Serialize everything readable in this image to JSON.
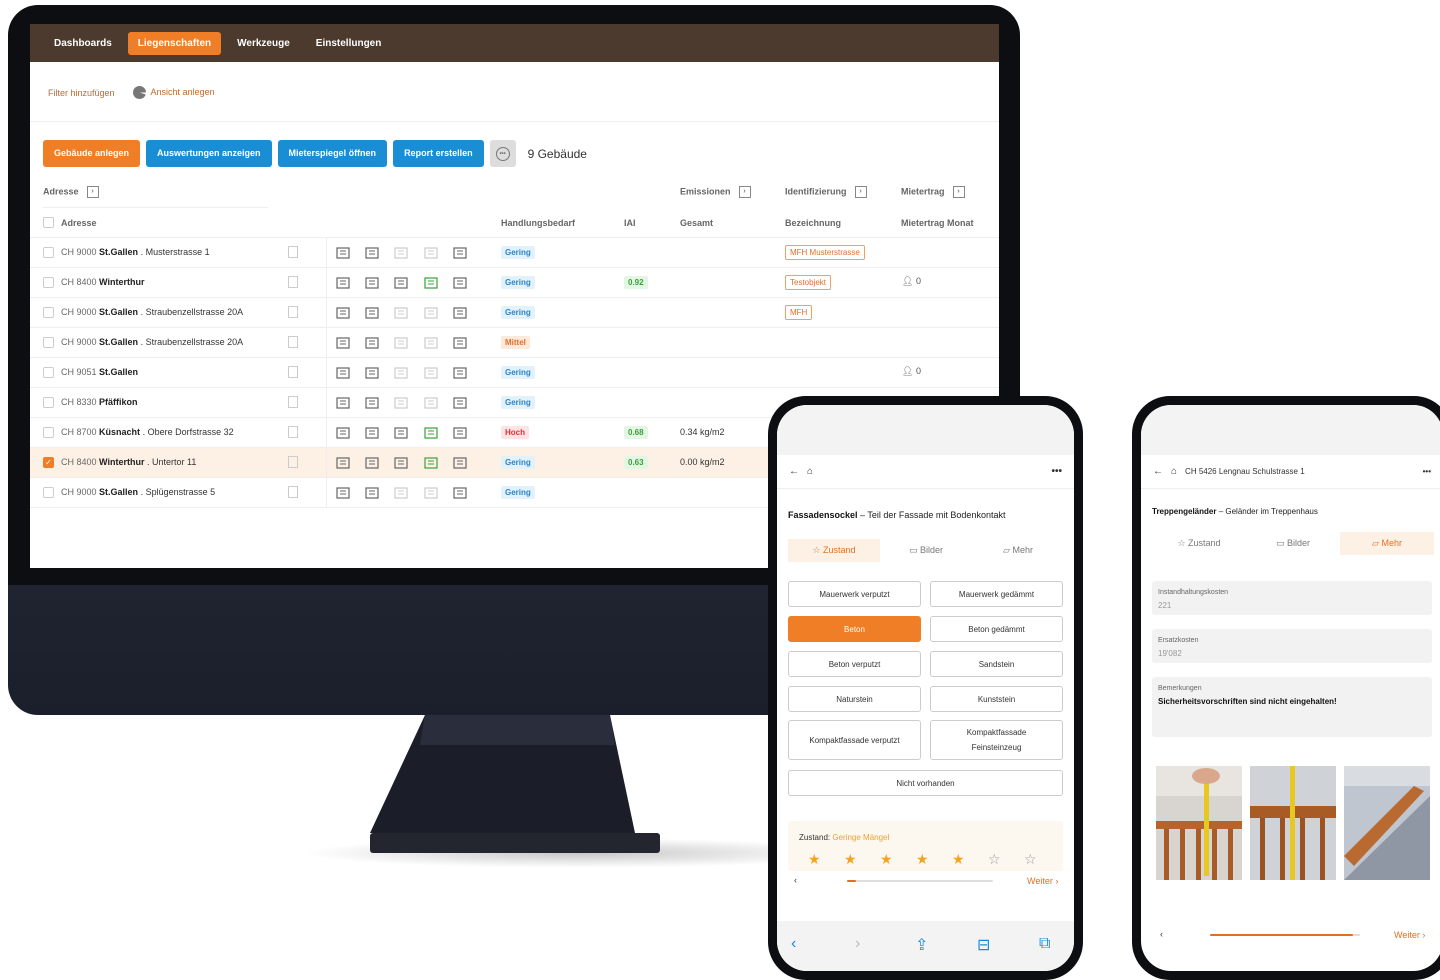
{
  "nav": {
    "tabs": [
      {
        "label": "Dashboards",
        "active": false
      },
      {
        "label": "Liegenschaften",
        "active": true
      },
      {
        "label": "Werkzeuge",
        "active": false
      },
      {
        "label": "Einstellungen",
        "active": false
      }
    ]
  },
  "filterbar": {
    "add_filter": "Filter hinzufügen",
    "create_view": "Ansicht anlegen"
  },
  "toolbar": {
    "create_building": "Gebäude anlegen",
    "show_reports": "Auswertungen anzeigen",
    "rent_index": "Mieterspiegel öffnen",
    "create_report": "Report erstellen",
    "more_icon": "more-icon",
    "count": "9 Gebäude"
  },
  "groups": {
    "adresse": "Adresse",
    "emissionen": "Emissionen",
    "identifizierung": "Identifizierung",
    "mietertrag": "Mietertrag"
  },
  "columns": {
    "adresse": "Adresse",
    "handlungsbedarf": "Handlungsbedarf",
    "iai": "IAI",
    "gesamt": "Gesamt",
    "bezeichnung": "Bezeichnung",
    "mietertrag_monat": "Mietertrag Monat"
  },
  "rows": [
    {
      "pre": "CH 9000",
      "city": "St.Gallen",
      "street": ". Musterstrasse 1",
      "need": "Gering",
      "iai": "",
      "em": "",
      "id": "MFH Musterstrasse",
      "rent": "",
      "selected": false
    },
    {
      "pre": "CH 8400",
      "city": "Winterthur",
      "street": "",
      "need": "Gering",
      "iai": "0.92",
      "em": "",
      "id": "Testobjekt",
      "rent": "0",
      "selected": false
    },
    {
      "pre": "CH 9000",
      "city": "St.Gallen",
      "street": ". Straubenzellstrasse 20A",
      "need": "Gering",
      "iai": "",
      "em": "",
      "id": "MFH",
      "rent": "",
      "selected": false
    },
    {
      "pre": "CH 9000",
      "city": "St.Gallen",
      "street": ". Straubenzellstrasse 20A",
      "need": "Mittel",
      "iai": "",
      "em": "",
      "id": "",
      "rent": "",
      "selected": false
    },
    {
      "pre": "CH 9051",
      "city": "St.Gallen",
      "street": "",
      "need": "Gering",
      "iai": "",
      "em": "",
      "id": "",
      "rent": "0",
      "selected": false
    },
    {
      "pre": "CH 8330",
      "city": "Pfäffikon",
      "street": "",
      "need": "Gering",
      "iai": "",
      "em": "",
      "id": "",
      "rent": "",
      "selected": false
    },
    {
      "pre": "CH 8700",
      "city": "Küsnacht",
      "street": ". Obere Dorfstrasse 32",
      "need": "Hoch",
      "iai": "0.68",
      "em": "0.34 kg/m2",
      "id": "",
      "rent": "",
      "selected": false
    },
    {
      "pre": "CH 8400",
      "city": "Winterthur",
      "street": ". Untertor 11",
      "need": "Gering",
      "iai": "0.63",
      "em": "0.00 kg/m2",
      "id": "",
      "rent": "",
      "selected": true
    },
    {
      "pre": "CH 9000",
      "city": "St.Gallen",
      "street": ". Splügenstrasse 5",
      "need": "Gering",
      "iai": "",
      "em": "",
      "id": "",
      "rent": "",
      "selected": false
    }
  ],
  "phone1": {
    "title_bold": "Fassadensockel",
    "title_rest": " – Teil der Fassade mit Bodenkontakt",
    "tabs": [
      "☆ Zustand",
      "▭ Bilder",
      "▱ Mehr"
    ],
    "options": [
      "Mauerwerk verputzt",
      "Mauerwerk gedämmt",
      "Beton",
      "Beton gedämmt",
      "Beton verputzt",
      "Sandstein",
      "Naturstein",
      "Kunststein",
      "Kompaktfassade verputzt",
      "Kompaktfassade Feinsteinzeug",
      "Nicht vorhanden"
    ],
    "zustand_label": "Zustand: ",
    "zustand_value": "Geringe Mängel",
    "rating": 5,
    "rating_max": 7,
    "next": "Weiter",
    "progress": 0.06
  },
  "phone2": {
    "breadcrumb": "CH 5426 Lengnau Schulstrasse 1",
    "title_bold": "Treppengeländer",
    "title_rest": " – Geländer im Treppenhaus",
    "tabs": [
      "☆ Zustand",
      "▭ Bilder",
      "▱ Mehr"
    ],
    "fields": [
      {
        "label": "Instandhaltungskosten",
        "value": "221"
      },
      {
        "label": "Ersatzkosten",
        "value": "19'082"
      },
      {
        "label": "Bemerkungen",
        "value": "Sicherheitsvorschriften sind nicht eingehalten!"
      }
    ],
    "next": "Weiter",
    "progress": 0.95
  },
  "colors": {
    "accent": "#f07e26",
    "blue": "#1a8ed4",
    "nav": "#4b3a2d"
  }
}
